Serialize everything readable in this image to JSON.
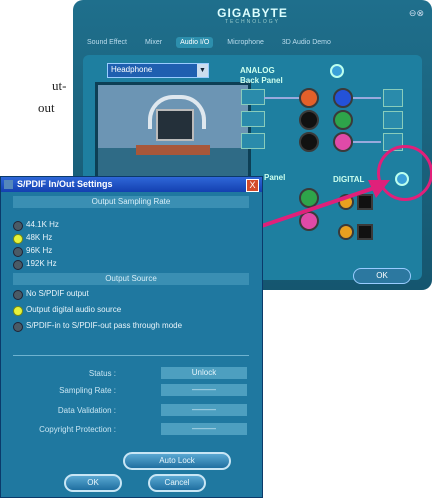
{
  "background_text": {
    "line1": "ut-",
    "line2": "out"
  },
  "audio_manager": {
    "brand": "GIGABYTE",
    "brand_sub": "TECHNOLOGY",
    "tabs": [
      "Sound Effect",
      "Mixer",
      "Audio I/O",
      "Microphone",
      "3D Audio Demo"
    ],
    "active_tab_index": 2,
    "device_select": "Headphone",
    "analog_label": "ANALOG",
    "back_panel_label": "Back Panel",
    "front_panel_label": "Panel",
    "digital_label": "DIGITAL",
    "ok_label": "OK"
  },
  "dialog": {
    "title": "S/PDIF In/Out Settings",
    "close_label": "X",
    "output_sampling_header": "Output Sampling Rate",
    "rates": [
      {
        "label": "44.1K Hz",
        "selected": false
      },
      {
        "label": "48K Hz",
        "selected": true
      },
      {
        "label": "96K Hz",
        "selected": false
      },
      {
        "label": "192K Hz",
        "selected": false
      }
    ],
    "output_source_header": "Output Source",
    "sources": [
      {
        "label": "No S/PDIF output",
        "selected": false
      },
      {
        "label": "Output digital audio source",
        "selected": true
      },
      {
        "label": "S/PDIF-in to S/PDIF-out pass through mode",
        "selected": false
      }
    ],
    "fields": [
      {
        "label": "Status :",
        "value": "Unlock"
      },
      {
        "label": "Sampling Rate :",
        "value": "———"
      },
      {
        "label": "Data Validation :",
        "value": "———"
      },
      {
        "label": "Copyright Protection :",
        "value": "———"
      }
    ],
    "auto_lock_label": "Auto Lock",
    "ok_label": "OK",
    "cancel_label": "Cancel"
  },
  "colors": {
    "highlight": "#e0207a",
    "accent": "#1f78a0"
  }
}
